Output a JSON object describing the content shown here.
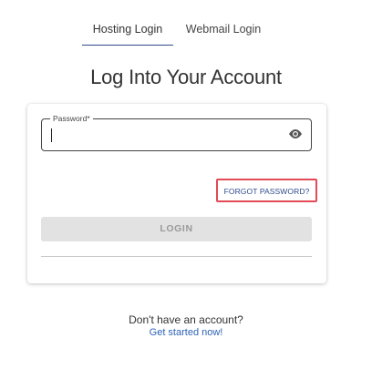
{
  "tabs": [
    {
      "label": "Hosting Login",
      "active": true
    },
    {
      "label": "Webmail Login",
      "active": false
    }
  ],
  "title": "Log Into Your Account",
  "password": {
    "label": "Password",
    "required_marker": "*",
    "value": "",
    "visibility_icon": "eye-icon"
  },
  "forgot_password": "FORGOT PASSWORD?",
  "login_button": "LOGIN",
  "footer": {
    "prompt": "Don't have an account?",
    "link": "Get started now!"
  },
  "colors": {
    "accent": "#2e4a8c",
    "link": "#2e63b8",
    "highlight_box": "#e24a55",
    "disabled_button_bg": "#e2e2e2",
    "disabled_button_text": "#9a9a9a"
  }
}
